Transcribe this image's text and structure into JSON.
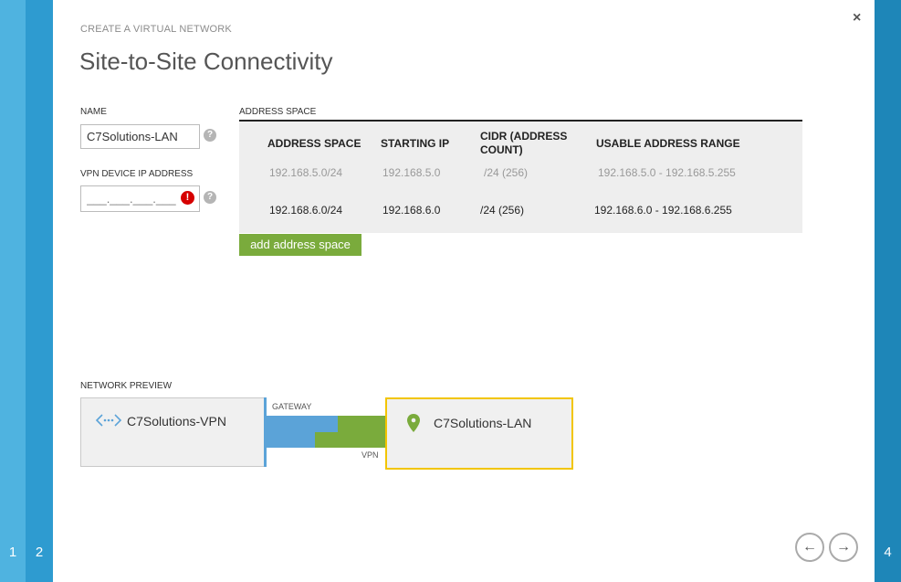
{
  "steps": {
    "step1": "1",
    "step2": "2",
    "step4": "4"
  },
  "header": {
    "eyebrow": "CREATE A VIRTUAL NETWORK",
    "title": "Site-to-Site Connectivity",
    "close_glyph": "×"
  },
  "form": {
    "name_label": "NAME",
    "name_value": "C7Solutions-LAN",
    "vpn_ip_label": "VPN DEVICE IP ADDRESS",
    "vpn_ip_placeholder": "___.___.___.___",
    "help_glyph": "?",
    "error_glyph": "!"
  },
  "address_space": {
    "section_label": "ADDRESS SPACE",
    "columns": {
      "address_space": "ADDRESS SPACE",
      "starting_ip": "STARTING IP",
      "cidr": "CIDR (ADDRESS COUNT)",
      "usable_range": "USABLE ADDRESS RANGE"
    },
    "rows": [
      {
        "address_space": "192.168.5.0/24",
        "starting_ip": "192.168.5.0",
        "cidr": "/24 (256)",
        "usable_range": "192.168.5.0 - 192.168.5.255"
      },
      {
        "address_space": "192.168.6.0/24",
        "starting_ip": "192.168.6.0",
        "cidr": "/24 (256)",
        "usable_range": "192.168.6.0 - 192.168.6.255"
      }
    ],
    "add_button": "add address space"
  },
  "preview": {
    "section_label": "NETWORK PREVIEW",
    "vpn_node": "C7Solutions-VPN",
    "lan_node": "C7Solutions-LAN",
    "gateway_label": "GATEWAY",
    "vpn_label": "VPN",
    "vpn_icon": "virtual-network-icon",
    "lan_icon": "location-pin-icon"
  },
  "nav": {
    "back_glyph": "←",
    "next_glyph": "→"
  },
  "colors": {
    "accent_blue": "#5ba3d8",
    "accent_green": "#7aab3c",
    "highlight_yellow": "#f2c500",
    "error_red": "#d60000"
  }
}
